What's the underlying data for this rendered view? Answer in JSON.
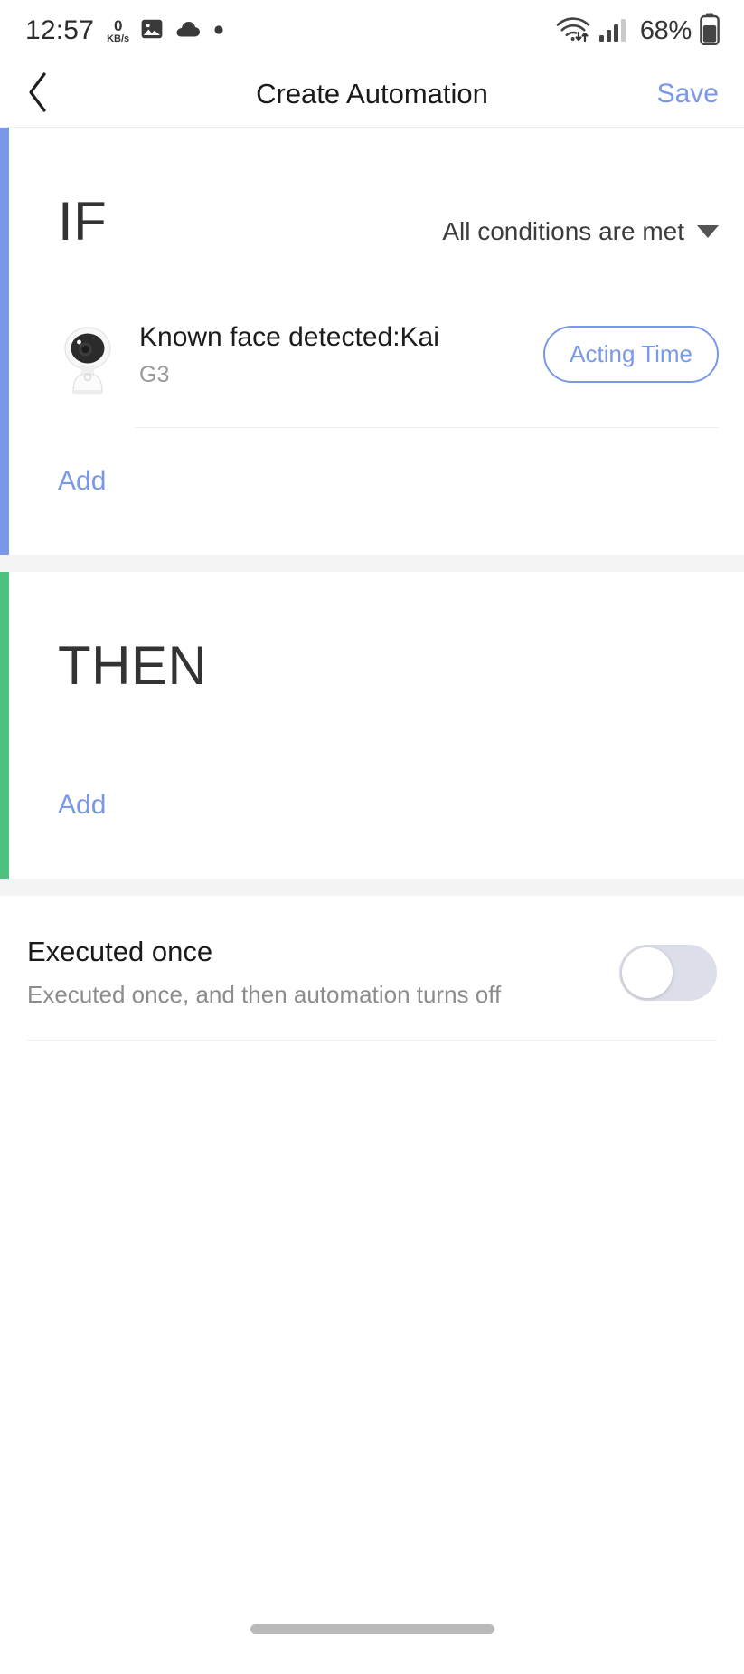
{
  "status_bar": {
    "time": "12:57",
    "net_speed_value": "0",
    "net_speed_unit": "KB/s",
    "icons": [
      "image-icon",
      "cloud-icon",
      "dot-icon",
      "wifi-icon",
      "cellular-signal-icon",
      "battery-icon"
    ],
    "battery_percent": "68%"
  },
  "header": {
    "back_icon": "chevron-left-icon",
    "title": "Create Automation",
    "save_label": "Save"
  },
  "if_section": {
    "title": "IF",
    "condition_mode": "All conditions are met",
    "caret_icon": "caret-down-icon",
    "trigger": {
      "device_icon": "security-camera-icon",
      "title": "Known face detected:Kai",
      "device_name": "G3",
      "action_pill_label": "Acting Time"
    },
    "add_label": "Add",
    "accent_color": "#7a98e8"
  },
  "then_section": {
    "title": "THEN",
    "add_label": "Add",
    "accent_color": "#4cc07c"
  },
  "executed_once": {
    "title": "Executed once",
    "subtitle": "Executed once, and then automation turns off",
    "toggle_state": "off"
  },
  "colors": {
    "accent_blue": "#7a98e8",
    "accent_green": "#4cc07c",
    "page_bg": "#f4f4f4",
    "text_primary": "#1a1a1a",
    "text_secondary": "#8c8c8c"
  }
}
